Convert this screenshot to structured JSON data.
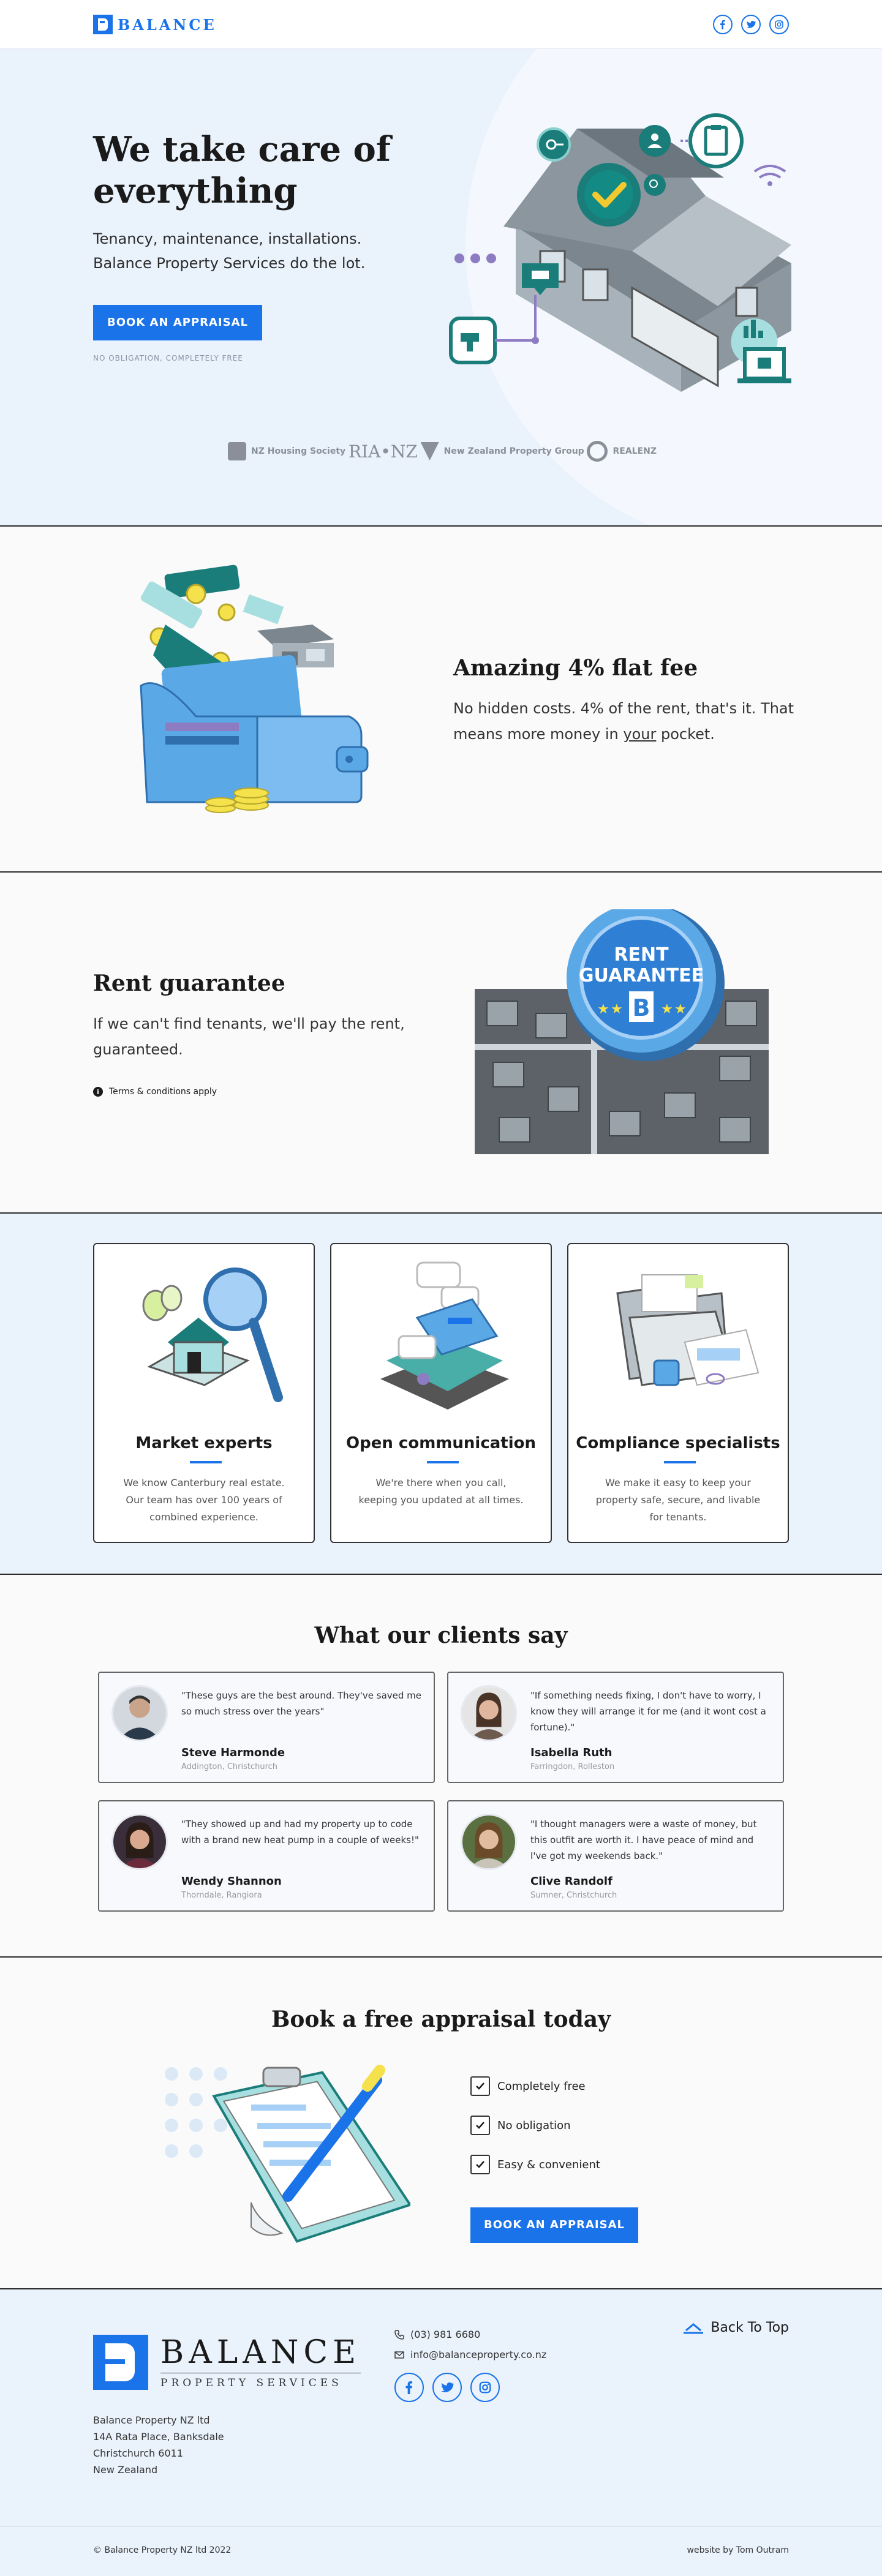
{
  "brand": {
    "name": "BALANCE",
    "tagline": "PROPERTY SERVICES",
    "accent": "#1a73e8"
  },
  "nav": {
    "socials": [
      "facebook-icon",
      "twitter-icon",
      "instagram-icon"
    ]
  },
  "hero": {
    "title": "We take care of everything",
    "subtitle": "Tenancy, maintenance, installations. Balance Property Services do the lot.",
    "cta": "BOOK AN APPRAISAL",
    "note": "NO OBLIGATION, COMPLETELY FREE",
    "partners": [
      "NZ Housing Society",
      "RIA•NZ",
      "New Zealand Property Group",
      "REALENZ"
    ]
  },
  "fee": {
    "title": "Amazing 4% flat fee",
    "text_a": "No hidden costs. 4% of the rent, that's it. That means more money in ",
    "text_u": "your",
    "text_b": " pocket."
  },
  "rent": {
    "title": "Rent guarantee",
    "text": "If we can't find tenants, we'll pay the rent, guaranteed.",
    "terms": "Terms & conditions apply",
    "badge_line1": "RENT",
    "badge_line2": "GUARANTEE",
    "badge_letter": "B"
  },
  "features": [
    {
      "title": "Market experts",
      "text": "We know Canterbury real estate. Our team has over 100 years of combined experience."
    },
    {
      "title": "Open communication",
      "text": "We're there when you call, keeping you updated at all times."
    },
    {
      "title": "Compliance specialists",
      "text": "We make it easy to keep your property safe, secure, and livable for tenants."
    }
  ],
  "testimonials": {
    "title": "What our clients say",
    "items": [
      {
        "quote": "\"These guys are the best around. They've saved me so much stress over the years\"",
        "name": "Steve Harmonde",
        "location": "Addington, Christchurch"
      },
      {
        "quote": "\"If something needs fixing, I don't have to worry, I know they will arrange it for me (and it wont cost a fortune).\"",
        "name": "Isabella Ruth",
        "location": "Farringdon, Rolleston"
      },
      {
        "quote": "\"They showed up and had my property up to code with a brand new heat pump in a couple of weeks!\"",
        "name": "Wendy Shannon",
        "location": "Thorndale, Rangiora"
      },
      {
        "quote": "\"I thought managers were a waste of money, but this outfit are worth it. I have peace of mind and I've got my weekends back.\"",
        "name": "Clive Randolf",
        "location": "Sumner, Christchurch"
      }
    ]
  },
  "appraisal": {
    "title": "Book a free appraisal today",
    "checks": [
      "Completely free",
      "No obligation",
      "Easy & convenient"
    ],
    "cta": "BOOK AN APPRAISAL"
  },
  "footer": {
    "company": "Balance Property NZ ltd",
    "address1": "14A Rata Place, Banksdale",
    "address2": "Christchurch 6011",
    "address3": "New Zealand",
    "phone": "(03) 981 6680",
    "email": "info@balanceproperty.co.nz",
    "back_to_top": "Back To Top",
    "copyright": "© Balance Property NZ ltd 2022",
    "credit": "website by Tom Outram"
  }
}
